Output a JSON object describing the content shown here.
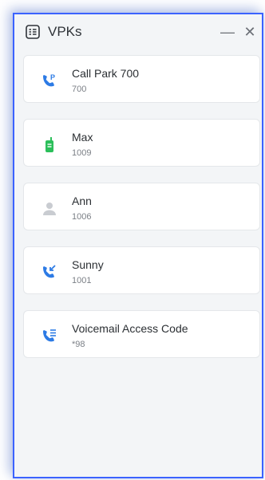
{
  "window": {
    "title": "VPKs",
    "minimize_label": "—",
    "close_label": "✕"
  },
  "items": [
    {
      "name": "Call Park 700",
      "number": "700",
      "icon": "call-park-icon",
      "color": "#2d7be5"
    },
    {
      "name": "Max",
      "number": "1009",
      "icon": "walkie-talkie-icon",
      "color": "#2bbf5a"
    },
    {
      "name": "Ann",
      "number": "1006",
      "icon": "contact-person-icon",
      "color": "#c9ccd1"
    },
    {
      "name": "Sunny",
      "number": "1001",
      "icon": "call-pickup-icon",
      "color": "#2d7be5"
    },
    {
      "name": "Voicemail Access Code",
      "number": "*98",
      "icon": "voicemail-icon",
      "color": "#2d7be5"
    }
  ]
}
